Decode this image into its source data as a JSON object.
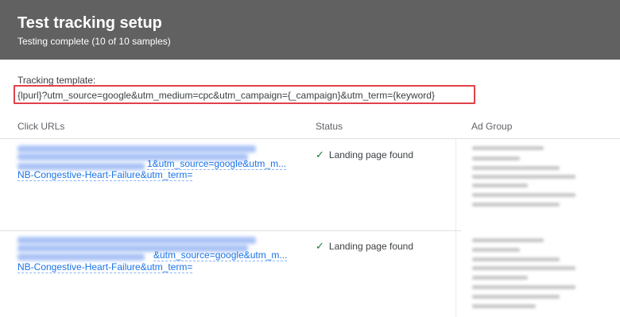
{
  "header": {
    "title": "Test tracking setup",
    "subtitle": "Testing complete (10 of 10 samples)"
  },
  "tracking_template": {
    "label": "Tracking template:",
    "value": "{lpurl}?utm_source=google&utm_medium=cpc&utm_campaign={_campaign}&utm_term={keyword}"
  },
  "table": {
    "columns": [
      "Click URLs",
      "Status",
      "Ad Group"
    ],
    "rows": [
      {
        "url_line2": "1&utm_source=google&utm_m...",
        "url_line3": "NB-Congestive-Heart-Failure&utm_term=",
        "status": "Landing page found"
      },
      {
        "url_line2": "&utm_source=google&utm_m...",
        "url_line3": "NB-Congestive-Heart-Failure&utm_term=",
        "status": "Landing page found"
      }
    ]
  },
  "icons": {
    "status_ok": "check-icon"
  },
  "colors": {
    "header_bg": "#616161",
    "highlight_border": "#e0424a",
    "link": "#1a73e8",
    "status_ok": "#188038"
  }
}
